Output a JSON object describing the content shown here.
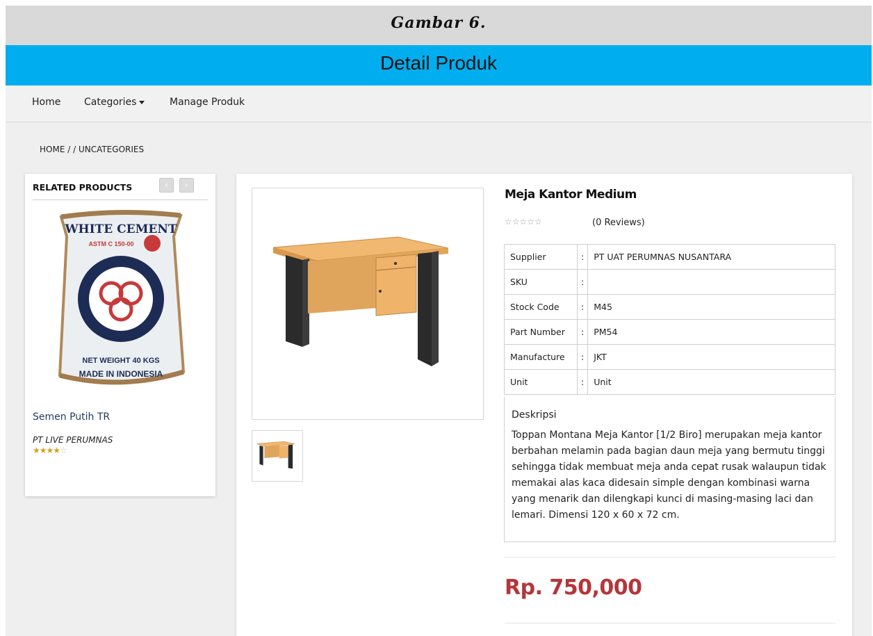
{
  "figure_caption": "Gambar 6.",
  "page_title": "Detail Produk",
  "nav": {
    "home": "Home",
    "categories": "Categories",
    "manage": "Manage Produk"
  },
  "breadcrumb": {
    "home": "HOME",
    "sep": " / / ",
    "current": "UNCATEGORIES"
  },
  "related": {
    "heading": "RELATED PRODUCTS",
    "prev_label": "‹",
    "next_label": "›",
    "product": {
      "name": "Semen Putih TR",
      "supplier": "PT LIVE PERUMNAS",
      "rating": 4,
      "rating_max": 5,
      "bag_text": {
        "top": "WHITE CEMENT",
        "astm": "ASTM C 150-00",
        "weight": "NET WEIGHT 40 KGS",
        "made": "MADE IN INDONESIA"
      }
    }
  },
  "product": {
    "title": "Meja Kantor Medium",
    "stars": "☆☆☆☆☆",
    "reviews": "(0 Reviews)",
    "specs": [
      {
        "label": "Supplier",
        "sep": ":",
        "value": "PT UAT PERUMNAS NUSANTARA"
      },
      {
        "label": "SKU",
        "sep": ":",
        "value": ""
      },
      {
        "label": "Stock Code",
        "sep": ":",
        "value": "M45"
      },
      {
        "label": "Part Number",
        "sep": ":",
        "value": "PM54"
      },
      {
        "label": "Manufacture",
        "sep": ":",
        "value": "JKT"
      },
      {
        "label": "Unit",
        "sep": ":",
        "value": "Unit"
      }
    ],
    "description_label": "Deskripsi",
    "description": "Toppan Montana Meja Kantor [1/2 Biro] merupakan meja kantor berbahan melamin pada bagian daun meja yang bermutu tinggi sehingga tidak membuat meja anda cepat rusak walaupun tidak memakai alas kaca didesain simple dengan kombinasi warna yang menarik dan dilengkapi kunci di masing-masing laci dan lemari. Dimensi 120 x 60 x 72 cm.",
    "price": "Rp. 750,000"
  },
  "colors": {
    "title_bar": "#00aeef",
    "caption_bar": "#d9d9d9",
    "price": "#b5353a",
    "star_on": "#d3a21a"
  }
}
